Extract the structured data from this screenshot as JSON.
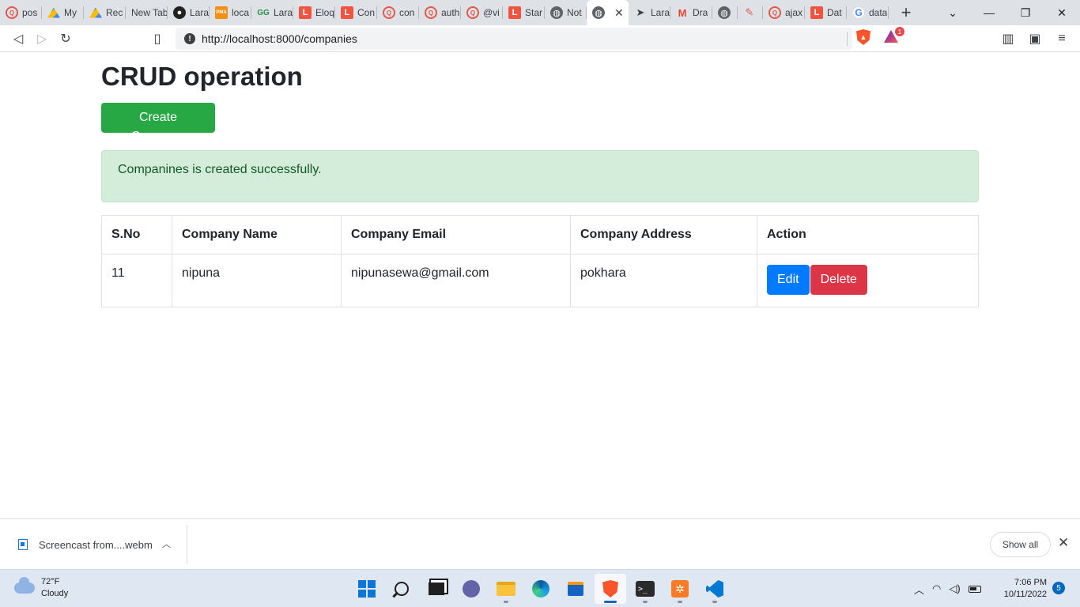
{
  "browser": {
    "tabs": [
      {
        "label": "pos",
        "icon": "brave-search-icon",
        "active": false
      },
      {
        "label": "My",
        "icon": "google-drive-icon",
        "active": false
      },
      {
        "label": "Rec",
        "icon": "google-drive-icon",
        "active": false
      },
      {
        "label": "New Tab",
        "icon": "",
        "active": false
      },
      {
        "label": "Lara",
        "icon": "bomb-icon",
        "active": false
      },
      {
        "label": "loca",
        "icon": "phpmyadmin-icon",
        "active": false
      },
      {
        "label": "Lara",
        "icon": "geeksforgeeks-icon",
        "active": false
      },
      {
        "label": "Eloq",
        "icon": "laravel-icon",
        "active": false
      },
      {
        "label": "Con",
        "icon": "laravel-icon",
        "active": false
      },
      {
        "label": "con",
        "icon": "brave-search-icon",
        "active": false
      },
      {
        "label": "auth",
        "icon": "brave-search-icon",
        "active": false
      },
      {
        "label": "@vi",
        "icon": "brave-search-icon",
        "active": false
      },
      {
        "label": "Star",
        "icon": "laravel-icon",
        "active": false
      },
      {
        "label": "Not",
        "icon": "globe-icon",
        "active": false
      },
      {
        "label": "",
        "icon": "globe-icon",
        "active": true
      },
      {
        "label": "Lara",
        "icon": "telegram-icon",
        "active": false
      },
      {
        "label": "Dra",
        "icon": "gmail-icon",
        "active": false
      },
      {
        "label": "",
        "icon": "globe-icon",
        "active": false
      },
      {
        "label": "",
        "icon": "pen-icon",
        "active": false
      },
      {
        "label": "ajax",
        "icon": "brave-search-icon",
        "active": false
      },
      {
        "label": "Dat",
        "icon": "laravel-icon",
        "active": false
      },
      {
        "label": "data",
        "icon": "google-icon",
        "active": false
      }
    ],
    "address": {
      "url": "http://localhost:8000/companies"
    },
    "rewards_badge": "1"
  },
  "page": {
    "title": "CRUD operation",
    "create_button": "Create Company",
    "alert": "Companines is created successfully.",
    "table": {
      "headers": [
        "S.No",
        "Company Name",
        "Company Email",
        "Company Address",
        "Action"
      ],
      "rows": [
        {
          "sno": "11",
          "name": "nipuna",
          "email": "nipunasewa@gmail.com",
          "address": "pokhara",
          "edit_label": "Edit",
          "delete_label": "Delete"
        }
      ]
    }
  },
  "downloads": {
    "file_name": "Screencast from....webm",
    "show_all": "Show all"
  },
  "taskbar": {
    "weather_temp": "72°F",
    "weather_desc": "Cloudy",
    "time": "7:06 PM",
    "date": "10/11/2022",
    "notifications": "5"
  },
  "colors": {
    "success": "#28a745",
    "primary": "#007bff",
    "danger": "#dc3545",
    "alert_bg": "#d4edda",
    "alert_text": "#155724"
  }
}
